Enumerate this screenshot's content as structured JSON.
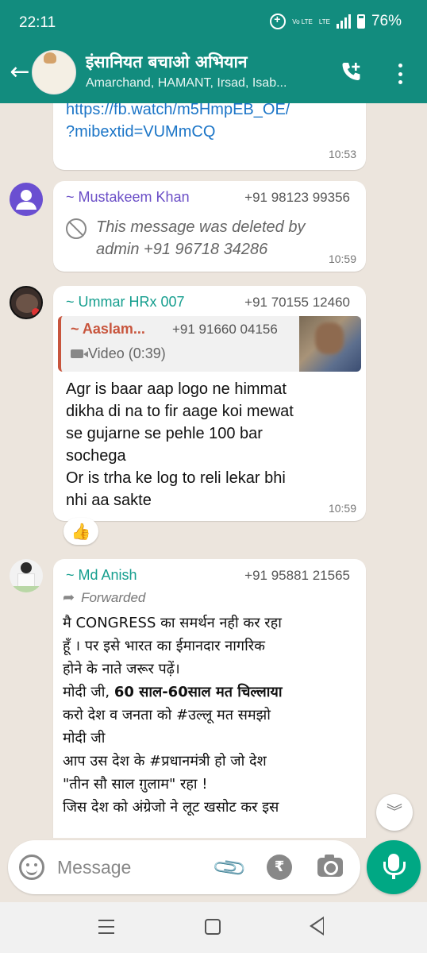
{
  "status_bar": {
    "time": "22:11",
    "network_label_top": "Vo LTE",
    "network_label_bottom": "LTE",
    "battery_percent": "76%",
    "battery_level": 0.76,
    "signal_bars": 4
  },
  "header": {
    "title": "इंसानियत बचाओ अभियान",
    "subtitle": "Amarchand, HAMANT, Irsad, Isab...",
    "avatar_text": "इंसानियत व जूल्म के खिलाफ़ तो सच्चाई से"
  },
  "messages": [
    {
      "type": "link",
      "text": "https://fb.watch/m5HmpEB_OE/\n?mibextid=VUMmCQ",
      "line1": "https://fb.watch/m5HmpEB_OE/",
      "line2": "?mibextid=VUMmCQ",
      "time": "10:53"
    },
    {
      "type": "deleted",
      "sender": "~ Mustakeem Khan",
      "phone": "+91 98123 99356",
      "text": "This message was deleted by admin +91 96718 34286",
      "time": "10:59"
    },
    {
      "type": "reply",
      "sender": "~ Ummar HRx 007",
      "phone": "+91 70155 12460",
      "quote": {
        "sender": "~ Aaslam...",
        "phone": "+91 91660 04156",
        "media": "Video (0:39)"
      },
      "text": "Agr is baar aap logo ne himmat dikha di na to fir aage koi mewat se gujarne se pehle 100 bar sochega\nOr is trha ke log to reli  lekar bhi nhi aa sakte",
      "line1": "Agr is baar aap logo ne himmat",
      "line2": "dikha di na to fir aage koi mewat",
      "line3": "se gujarne se pehle 100 bar",
      "line4": "sochega",
      "line5": "Or is trha ke log to reli  lekar bhi",
      "line6": "nhi aa sakte",
      "time": "10:59",
      "reaction": "👍"
    },
    {
      "type": "forwarded",
      "sender": "~ Md Anish",
      "phone": "+91 95881 21565",
      "forwarded_label": "Forwarded",
      "line1": "मै CONGRESS का समर्थन नही कर रहा",
      "line2": "हूँ । पर इसे भारत का ईमानदार नागरिक",
      "line3": "होने के नाते जरूर पढ़ें।",
      "line4_plain": "मोदी जी, ",
      "line4_bold": "60 साल-60साल मत चिल्लाया",
      "line5": "करो देश व जनता को #उल्लू मत समझो",
      "line6": "मोदी जी",
      "line7": "आप उस देश के #प्रधानमंत्री हो जो देश",
      "line8": "\"तीन सौ साल ग़ुलाम\" रहा !",
      "line9": "जिस देश को अंग्रेजो ने लूट खसोट कर इस"
    }
  ],
  "composer": {
    "placeholder": "Message",
    "rupee_symbol": "₹"
  },
  "colors": {
    "header": "#128c7e",
    "chat_bg": "#ece5dd",
    "accent_green": "#00a884",
    "link": "#1b75c7",
    "sender_purple": "#6b4fc7",
    "sender_teal": "#159e8e",
    "quote_accent": "#c8553d"
  },
  "icons": {
    "back": "arrow-left-icon",
    "add_call": "add-call-icon",
    "more": "more-vert-icon",
    "deleted": "blocked-icon",
    "forwarded": "forward-arrow-icon",
    "video": "video-icon",
    "emoji": "emoji-icon",
    "attach": "paperclip-icon",
    "payment": "rupee-icon",
    "camera": "camera-icon",
    "mic": "mic-icon",
    "scroll_down": "double-chevron-down-icon"
  }
}
